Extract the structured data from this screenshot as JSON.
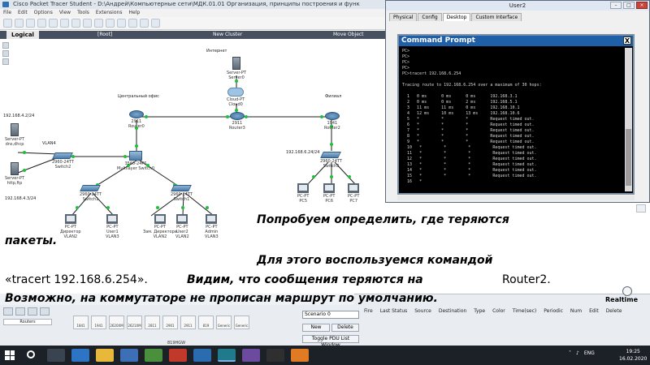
{
  "main_window": {
    "title": "Cisco Packet Tracer Student - D:\\Андрей\\Компьютерные сети\\МДК.01.01 Организация, принципы построения и функ",
    "menu": [
      "File",
      "Edit",
      "Options",
      "View",
      "Tools",
      "Extensions",
      "Help"
    ],
    "workspace": {
      "mode": "Logical",
      "root": "[Root]",
      "cluster": "New Cluster",
      "move": "Move Object"
    }
  },
  "topology": {
    "labels": {
      "internet": "Интернет",
      "central_office": "Центральный офис",
      "branch": "Филиал",
      "net_42": "192.168.4.2/24",
      "vlan4": "VLAN4",
      "net_43": "192.168.4.3/24",
      "net_624": "192.168.6.24/24"
    },
    "devices": {
      "server0": [
        "Server-PT",
        "Server0"
      ],
      "cloud0": [
        "Cloud-PT",
        "Cloud0"
      ],
      "router0": [
        "2911",
        "Router0"
      ],
      "router3": [
        "2911",
        "Router3"
      ],
      "router2": [
        "1941",
        "Router2"
      ],
      "srv_dns": [
        "Server-PT",
        "dns,dhcp"
      ],
      "srv_http": [
        "Server-PT",
        "http,ftp"
      ],
      "switch2": [
        "2960-24TT",
        "Switch2"
      ],
      "mls0": [
        "3560-24PS",
        "Multilayer Switch0"
      ],
      "switchA": [
        "2960-24TT",
        "Switch1"
      ],
      "switchB": [
        "2960-24TT",
        "Switch1"
      ],
      "switchBr": [
        "2960-24TT",
        "Switch3"
      ],
      "pc_dir": [
        "PC-PT",
        "Директор",
        "VLAN2"
      ],
      "pc_user1": [
        "PC-PT",
        "User1",
        "VLAN3"
      ],
      "pc_zam": [
        "PC-PT",
        "Зам. Директора",
        "VLAN2"
      ],
      "pc_user2": [
        "PC-PT",
        "User2",
        "VLAN2"
      ],
      "pc_admin": [
        "PC-PT",
        "Admin",
        "VLAN3"
      ],
      "pc5": [
        "PC-PT",
        "PC5"
      ],
      "pc6": [
        "PC-PT",
        "PC6"
      ],
      "pc7": [
        "PC-PT",
        "PC7"
      ]
    }
  },
  "narration": {
    "line1": "Попробуем определить, где теряются",
    "line2": "пакеты.",
    "line3": "Для этого воспользуемся командой",
    "line4a": "«tracert 192.168.6.254».",
    "line4b": "Видим, что сообщения теряются на",
    "line4c": "Router2.",
    "line5": "Возможно, на коммутаторе не прописан маршрут по умолчанию."
  },
  "bottom_panel": {
    "realtime": "Realtime",
    "category": "Routers",
    "device_models": [
      "1841",
      "1941",
      "2620XM",
      "2621XM",
      "2811",
      "2901",
      "2911",
      "819",
      "Generic",
      "Generic"
    ],
    "device_code": "819HGW",
    "scenario": "Scenario 0",
    "new_btn": "New",
    "delete_btn": "Delete",
    "toggle_btn": "Toggle PDU List Window",
    "pdu_columns": [
      "Fire",
      "Last Status",
      "Source",
      "Destination",
      "Type",
      "Color",
      "Time(sec)",
      "Periodic",
      "Num",
      "Edit",
      "Delete"
    ]
  },
  "user2_window": {
    "title": "User2",
    "tabs": [
      "Physical",
      "Config",
      "Desktop",
      "Custom Interface"
    ],
    "active_tab": "Desktop",
    "cmd_title": "Command Prompt",
    "cmd_close": "X",
    "cmd_lines": [
      "PC>",
      "PC>",
      "PC>",
      "PC>",
      "PC>tracert 192.168.6.254",
      "",
      "Tracing route to 192.168.6.254 over a maximum of 30 hops:",
      "",
      "  1   0 ms      0 ms      0 ms      192.168.3.1",
      "  2   0 ms      0 ms      2 ms      192.168.5.1",
      "  3   11 ms     11 ms     0 ms      192.168.10.1",
      "  4   12 ms     10 ms     13 ms     192.168.10.6",
      "  5   *         *         *         Request timed out.",
      "  6   *         *         *         Request timed out.",
      "  7   *         *         *         Request timed out.",
      "  8   *         *         *         Request timed out.",
      "  9   *         *         *         Request timed out.",
      "  10   *         *         *         Request timed out.",
      "  11   *         *         *         Request timed out.",
      "  12   *         *         *         Request timed out.",
      "  13   *         *         *         Request timed out.",
      "  14   *         *         *         Request timed out.",
      "  15   *         *         *         Request timed out.",
      "  16   *"
    ]
  },
  "taskbar": {
    "lang": "ENG",
    "time": "19:25",
    "date": "16.02.2020"
  }
}
